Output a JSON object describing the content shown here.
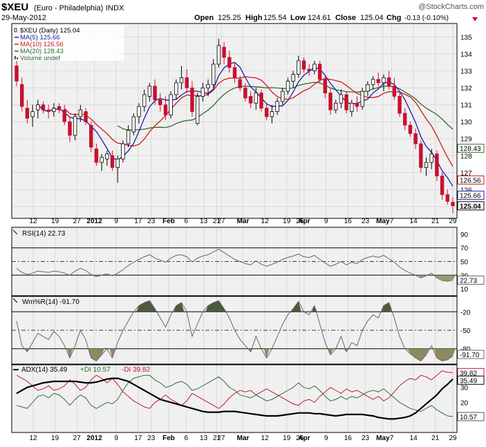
{
  "header": {
    "symbol": "$XEU",
    "description": "(Euro - Philadelphia)",
    "exchange": "INDX",
    "date": "29-May-2012",
    "watermark": "@StockCharts.com",
    "quote_open_label": "Open",
    "quote_open": "125.25",
    "quote_high_label": "High",
    "quote_high": "125.54",
    "quote_low_label": "Low",
    "quote_low": "124.61",
    "quote_close_label": "Close",
    "quote_close": "125.04",
    "quote_chg_label": "Chg",
    "quote_chg": "-0.13 (-0.10%)"
  },
  "colors": {
    "up": "#ffffff",
    "down": "#c8102e",
    "ma5": "#1a1aa8",
    "ma10": "#d01818",
    "ma20": "#2e6b2e",
    "rsi": "#666666",
    "fill_dark": "#4d5a3f",
    "fill_light": "#8c8a5e",
    "adx": "#000000",
    "plus_di": "#2e6b2e",
    "minus_di": "#c0143c",
    "grid": "#d9d9d9",
    "panel_bg": "#f0f0f0"
  },
  "chart_data": [
    {
      "type": "candlestick",
      "title": "$XEU (Daily) 125.04",
      "legend": [
        "$XEU (Daily) 125.04",
        "MA(5) 125.66",
        "MA(10) 126.56",
        "MA(20) 128.43",
        "Volume undef"
      ],
      "ylim": [
        124.3,
        135.8
      ],
      "y_ticks": [
        125,
        126,
        127,
        128,
        129,
        130,
        131,
        132,
        133,
        134,
        135
      ],
      "x_tick_labels": [
        "12",
        "19",
        "27",
        "2012",
        "9",
        "17",
        "23",
        "Feb",
        "6",
        "13",
        "21",
        "27",
        "Mar",
        "12",
        "19",
        "26",
        "Apr",
        "9",
        "16",
        "23",
        "May",
        "7",
        "14",
        "21",
        "29"
      ],
      "price_tags": [
        "128.43",
        "126.56",
        "125.66",
        "125.04"
      ],
      "candles": [
        {
          "o": 133.3,
          "h": 133.6,
          "l": 132.1,
          "c": 132.4
        },
        {
          "o": 132.2,
          "h": 132.6,
          "l": 130.6,
          "c": 130.9
        },
        {
          "o": 130.8,
          "h": 131.3,
          "l": 129.9,
          "c": 130.2
        },
        {
          "o": 130.3,
          "h": 131.0,
          "l": 129.7,
          "c": 130.6
        },
        {
          "o": 130.7,
          "h": 131.3,
          "l": 130.2,
          "c": 131.0
        },
        {
          "o": 131.0,
          "h": 131.2,
          "l": 130.5,
          "c": 130.7
        },
        {
          "o": 130.7,
          "h": 131.0,
          "l": 130.2,
          "c": 130.6
        },
        {
          "o": 130.6,
          "h": 131.1,
          "l": 130.3,
          "c": 130.8
        },
        {
          "o": 130.9,
          "h": 131.1,
          "l": 130.5,
          "c": 130.7
        },
        {
          "o": 130.7,
          "h": 131.0,
          "l": 129.8,
          "c": 130.0
        },
        {
          "o": 130.0,
          "h": 130.3,
          "l": 128.8,
          "c": 129.2
        },
        {
          "o": 129.2,
          "h": 130.5,
          "l": 128.9,
          "c": 130.3
        },
        {
          "o": 130.3,
          "h": 131.0,
          "l": 130.0,
          "c": 130.7
        },
        {
          "o": 130.6,
          "h": 130.8,
          "l": 129.8,
          "c": 130.0
        },
        {
          "o": 129.8,
          "h": 130.0,
          "l": 128.2,
          "c": 128.5
        },
        {
          "o": 128.4,
          "h": 128.7,
          "l": 127.4,
          "c": 127.6
        },
        {
          "o": 127.6,
          "h": 128.1,
          "l": 127.1,
          "c": 127.9
        },
        {
          "o": 127.8,
          "h": 128.3,
          "l": 127.4,
          "c": 128.1
        },
        {
          "o": 128.0,
          "h": 128.3,
          "l": 127.1,
          "c": 127.3
        },
        {
          "o": 127.3,
          "h": 128.0,
          "l": 126.4,
          "c": 127.8
        },
        {
          "o": 127.8,
          "h": 128.9,
          "l": 127.6,
          "c": 128.7
        },
        {
          "o": 128.7,
          "h": 129.8,
          "l": 128.5,
          "c": 129.5
        },
        {
          "o": 129.4,
          "h": 130.5,
          "l": 129.2,
          "c": 130.3
        },
        {
          "o": 130.3,
          "h": 131.1,
          "l": 129.9,
          "c": 130.9
        },
        {
          "o": 130.9,
          "h": 131.9,
          "l": 130.6,
          "c": 131.6
        },
        {
          "o": 131.5,
          "h": 132.3,
          "l": 131.2,
          "c": 132.1
        },
        {
          "o": 132.1,
          "h": 132.5,
          "l": 131.0,
          "c": 131.3
        },
        {
          "o": 131.3,
          "h": 131.7,
          "l": 130.6,
          "c": 131.0
        },
        {
          "o": 131.0,
          "h": 131.5,
          "l": 130.1,
          "c": 130.4
        },
        {
          "o": 130.4,
          "h": 131.8,
          "l": 130.2,
          "c": 131.6
        },
        {
          "o": 131.6,
          "h": 132.5,
          "l": 131.3,
          "c": 132.3
        },
        {
          "o": 132.3,
          "h": 133.3,
          "l": 131.9,
          "c": 132.6
        },
        {
          "o": 132.6,
          "h": 133.1,
          "l": 131.7,
          "c": 132.0
        },
        {
          "o": 132.0,
          "h": 132.4,
          "l": 130.3,
          "c": 130.6
        },
        {
          "o": 129.9,
          "h": 131.7,
          "l": 129.8,
          "c": 131.5
        },
        {
          "o": 131.5,
          "h": 132.3,
          "l": 131.2,
          "c": 132.0
        },
        {
          "o": 132.0,
          "h": 132.5,
          "l": 131.5,
          "c": 132.2
        },
        {
          "o": 132.2,
          "h": 133.7,
          "l": 132.0,
          "c": 133.4
        },
        {
          "o": 133.4,
          "h": 134.9,
          "l": 133.2,
          "c": 134.5
        },
        {
          "o": 134.4,
          "h": 134.7,
          "l": 133.4,
          "c": 133.8
        },
        {
          "o": 133.8,
          "h": 134.2,
          "l": 132.9,
          "c": 133.2
        },
        {
          "o": 133.2,
          "h": 133.5,
          "l": 132.3,
          "c": 132.6
        },
        {
          "o": 132.5,
          "h": 132.7,
          "l": 131.8,
          "c": 132.0
        },
        {
          "o": 132.0,
          "h": 132.3,
          "l": 131.2,
          "c": 131.4
        },
        {
          "o": 131.5,
          "h": 131.8,
          "l": 130.8,
          "c": 131.1
        },
        {
          "o": 131.1,
          "h": 132.0,
          "l": 130.7,
          "c": 131.7
        },
        {
          "o": 131.7,
          "h": 131.9,
          "l": 130.6,
          "c": 130.8
        },
        {
          "o": 130.8,
          "h": 131.1,
          "l": 130.1,
          "c": 130.3
        },
        {
          "o": 130.3,
          "h": 131.0,
          "l": 129.9,
          "c": 130.6
        },
        {
          "o": 130.6,
          "h": 131.4,
          "l": 130.4,
          "c": 131.2
        },
        {
          "o": 131.2,
          "h": 132.0,
          "l": 131.0,
          "c": 131.8
        },
        {
          "o": 131.8,
          "h": 132.6,
          "l": 131.6,
          "c": 132.4
        },
        {
          "o": 132.4,
          "h": 133.0,
          "l": 132.0,
          "c": 132.8
        },
        {
          "o": 132.8,
          "h": 133.9,
          "l": 132.6,
          "c": 133.6
        },
        {
          "o": 133.6,
          "h": 133.8,
          "l": 132.9,
          "c": 133.1
        },
        {
          "o": 133.1,
          "h": 133.4,
          "l": 132.7,
          "c": 133.0
        },
        {
          "o": 133.0,
          "h": 133.6,
          "l": 132.8,
          "c": 133.4
        },
        {
          "o": 133.4,
          "h": 133.6,
          "l": 132.3,
          "c": 132.5
        },
        {
          "o": 132.5,
          "h": 132.7,
          "l": 131.4,
          "c": 131.7
        },
        {
          "o": 131.7,
          "h": 132.0,
          "l": 130.4,
          "c": 130.7
        },
        {
          "o": 130.7,
          "h": 131.3,
          "l": 130.5,
          "c": 131.1
        },
        {
          "o": 131.1,
          "h": 131.9,
          "l": 130.8,
          "c": 131.6
        },
        {
          "o": 131.6,
          "h": 131.8,
          "l": 130.5,
          "c": 130.7
        },
        {
          "o": 130.6,
          "h": 131.3,
          "l": 130.3,
          "c": 131.1
        },
        {
          "o": 131.1,
          "h": 131.5,
          "l": 130.6,
          "c": 130.9
        },
        {
          "o": 130.9,
          "h": 132.0,
          "l": 130.7,
          "c": 131.8
        },
        {
          "o": 131.8,
          "h": 132.4,
          "l": 131.5,
          "c": 132.2
        },
        {
          "o": 132.2,
          "h": 132.7,
          "l": 131.9,
          "c": 132.5
        },
        {
          "o": 132.5,
          "h": 132.9,
          "l": 132.1,
          "c": 132.3
        },
        {
          "o": 132.3,
          "h": 132.8,
          "l": 131.8,
          "c": 132.6
        },
        {
          "o": 132.6,
          "h": 133.0,
          "l": 131.9,
          "c": 132.1
        },
        {
          "o": 132.1,
          "h": 132.6,
          "l": 131.3,
          "c": 131.5
        },
        {
          "o": 131.5,
          "h": 131.7,
          "l": 130.3,
          "c": 130.5
        },
        {
          "o": 130.5,
          "h": 130.8,
          "l": 129.5,
          "c": 129.8
        },
        {
          "o": 129.8,
          "h": 130.0,
          "l": 129.1,
          "c": 129.3
        },
        {
          "o": 129.3,
          "h": 129.6,
          "l": 128.4,
          "c": 128.7
        },
        {
          "o": 128.7,
          "h": 128.9,
          "l": 127.0,
          "c": 127.3
        },
        {
          "o": 127.3,
          "h": 127.9,
          "l": 126.8,
          "c": 127.6
        },
        {
          "o": 127.6,
          "h": 128.4,
          "l": 127.2,
          "c": 128.1
        },
        {
          "o": 128.1,
          "h": 128.3,
          "l": 126.5,
          "c": 126.8
        },
        {
          "o": 126.8,
          "h": 127.0,
          "l": 125.4,
          "c": 125.7
        },
        {
          "o": 125.7,
          "h": 126.0,
          "l": 125.1,
          "c": 125.3
        },
        {
          "o": 125.25,
          "h": 125.54,
          "l": 124.61,
          "c": 125.04
        }
      ]
    },
    {
      "type": "line",
      "title": "RSI(14) 22.73",
      "ylim": [
        0,
        100
      ],
      "y_ticks": [
        10,
        30,
        50,
        70,
        90
      ],
      "reference_lines": [
        30,
        50,
        70
      ],
      "price_tag": "22.73",
      "values": [
        40,
        34,
        31,
        33,
        36,
        35,
        34,
        36,
        35,
        33,
        30,
        36,
        40,
        37,
        31,
        28,
        30,
        32,
        29,
        33,
        38,
        44,
        49,
        53,
        57,
        60,
        55,
        52,
        49,
        55,
        59,
        60,
        57,
        49,
        55,
        58,
        60,
        64,
        68,
        63,
        58,
        53,
        50,
        47,
        45,
        51,
        46,
        43,
        46,
        49,
        53,
        56,
        58,
        61,
        57,
        56,
        59,
        53,
        48,
        43,
        46,
        50,
        45,
        49,
        47,
        53,
        56,
        58,
        56,
        59,
        54,
        49,
        42,
        37,
        33,
        30,
        26,
        29,
        33,
        26,
        22,
        21,
        22.73
      ]
    },
    {
      "type": "line",
      "title": "Wm%R(14) -91.70",
      "ylim": [
        -100,
        0
      ],
      "y_ticks": [
        -20,
        -50,
        -80
      ],
      "reference_lines": [
        -20,
        -50,
        -80
      ],
      "price_tag": "-91.70",
      "values": [
        -35,
        -75,
        -85,
        -70,
        -55,
        -60,
        -65,
        -52,
        -60,
        -75,
        -95,
        -75,
        -50,
        -65,
        -95,
        -100,
        -90,
        -80,
        -95,
        -70,
        -50,
        -35,
        -20,
        -10,
        -5,
        -2,
        -15,
        -30,
        -45,
        -25,
        -10,
        -5,
        -20,
        -60,
        -40,
        -20,
        -10,
        -5,
        -2,
        -15,
        -30,
        -50,
        -65,
        -75,
        -85,
        -60,
        -80,
        -95,
        -80,
        -60,
        -40,
        -25,
        -15,
        -3,
        -20,
        -25,
        -10,
        -40,
        -70,
        -90,
        -80,
        -60,
        -85,
        -70,
        -75,
        -50,
        -35,
        -25,
        -30,
        -10,
        -5,
        -30,
        -60,
        -80,
        -88,
        -95,
        -100,
        -90,
        -75,
        -95,
        -100,
        -98,
        -91.7
      ]
    },
    {
      "type": "line",
      "title": "ADX(14) 35.49 +DI 10.57 -DI 39.82",
      "ylim": [
        0,
        45
      ],
      "y_ticks": [
        10,
        20,
        30
      ],
      "price_tags": [
        "39.82",
        "35.49",
        "10.57"
      ],
      "series": [
        {
          "name": "ADX(14) 35.49",
          "values": [
            26,
            28,
            30,
            31,
            32,
            33,
            33.5,
            34,
            34,
            34,
            34,
            34,
            33.5,
            33,
            33,
            33.5,
            34.5,
            35.5,
            36,
            36,
            35,
            34,
            32,
            30,
            28,
            26,
            24,
            22,
            21,
            20,
            19,
            18,
            17,
            16,
            15,
            14,
            13.5,
            13.5,
            13.5,
            14,
            14,
            14,
            13.5,
            13,
            12.5,
            12,
            11.5,
            11,
            11,
            11,
            11.5,
            12,
            12.5,
            13,
            13,
            13,
            12.5,
            12.5,
            12,
            11.5,
            11,
            11.5,
            12,
            12,
            12,
            12,
            11.5,
            11,
            10,
            9.5,
            9,
            9,
            9.5,
            10,
            11,
            13,
            16,
            19,
            22,
            25,
            29,
            32,
            35.49
          ]
        },
        {
          "name": "+DI 10.57",
          "values": [
            18,
            17,
            16,
            20,
            24,
            25,
            23,
            26,
            25,
            22,
            18,
            22,
            25,
            23,
            18,
            16,
            18,
            20,
            19,
            22,
            28,
            33,
            36,
            37,
            38,
            38,
            35,
            33,
            30,
            31,
            33,
            34,
            32,
            28,
            29,
            31,
            33,
            35,
            37,
            34,
            30,
            28,
            25,
            24,
            23,
            25,
            23,
            21,
            22,
            24,
            26,
            28,
            30,
            33,
            30,
            29,
            31,
            28,
            24,
            21,
            22,
            24,
            22,
            24,
            23,
            25,
            27,
            28,
            27,
            29,
            26,
            23,
            20,
            18,
            16,
            15,
            14,
            16,
            18,
            15,
            13,
            11,
            10.57
          ]
        },
        {
          "name": "-DI 39.82",
          "values": [
            38,
            36,
            34,
            31,
            28,
            29,
            31,
            28,
            29,
            31,
            35,
            32,
            28,
            30,
            35,
            38,
            36,
            33,
            36,
            32,
            27,
            24,
            21,
            19,
            17,
            16,
            20,
            22,
            25,
            22,
            20,
            18,
            21,
            26,
            24,
            22,
            20,
            18,
            16,
            19,
            23,
            26,
            28,
            27,
            28,
            25,
            27,
            29,
            27,
            25,
            23,
            21,
            19,
            18,
            21,
            22,
            20,
            24,
            27,
            30,
            28,
            26,
            29,
            27,
            28,
            26,
            24,
            22,
            24,
            21,
            23,
            27,
            31,
            34,
            36,
            35,
            38,
            37,
            35,
            38,
            41,
            40,
            39.82
          ]
        }
      ]
    }
  ]
}
